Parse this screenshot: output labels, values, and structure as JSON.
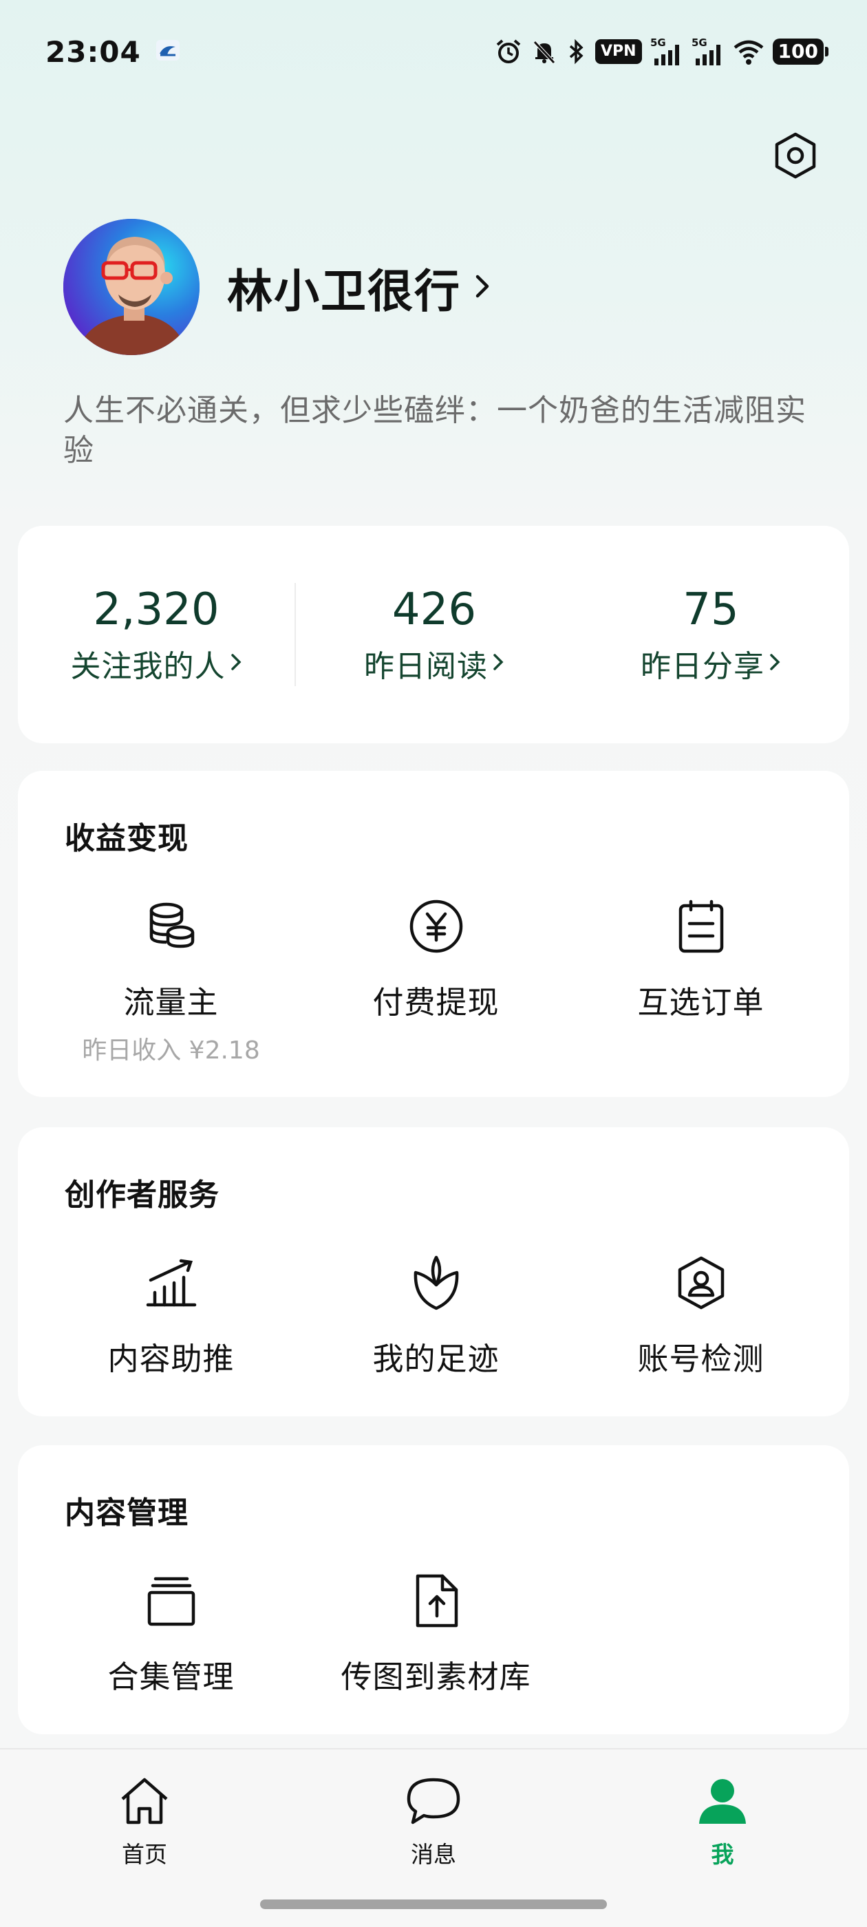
{
  "status_bar": {
    "time": "23:04",
    "vpn": "VPN",
    "net1": "5G",
    "net2": "5G",
    "battery": "100"
  },
  "profile": {
    "name": "林小卫很行",
    "bio": "人生不必通关，但求少些磕绊：一个奶爸的生活减阻实验"
  },
  "stats": [
    {
      "value": "2,320",
      "label": "关注我的人"
    },
    {
      "value": "426",
      "label": "昨日阅读"
    },
    {
      "value": "75",
      "label": "昨日分享"
    }
  ],
  "earnings": {
    "title": "收益变现",
    "items": [
      {
        "label": "流量主",
        "sub": "昨日收入 ¥2.18",
        "icon": "coins-icon"
      },
      {
        "label": "付费提现",
        "icon": "yen-circle-icon"
      },
      {
        "label": "互选订单",
        "icon": "clipboard-icon"
      }
    ]
  },
  "creator": {
    "title": "创作者服务",
    "items": [
      {
        "label": "内容助推",
        "icon": "growth-chart-icon"
      },
      {
        "label": "我的足迹",
        "icon": "leaf-icon"
      },
      {
        "label": "账号检测",
        "icon": "user-shield-icon"
      }
    ]
  },
  "content": {
    "title": "内容管理",
    "items": [
      {
        "label": "合集管理",
        "icon": "stack-icon"
      },
      {
        "label": "传图到素材库",
        "icon": "upload-file-icon"
      }
    ]
  },
  "tabs": [
    {
      "label": "首页",
      "icon": "home-icon"
    },
    {
      "label": "消息",
      "icon": "chat-bubble-icon"
    },
    {
      "label": "我",
      "icon": "person-icon",
      "active": true
    }
  ],
  "colors": {
    "accent": "#07a35a",
    "stat_text": "#0f3b2c"
  }
}
